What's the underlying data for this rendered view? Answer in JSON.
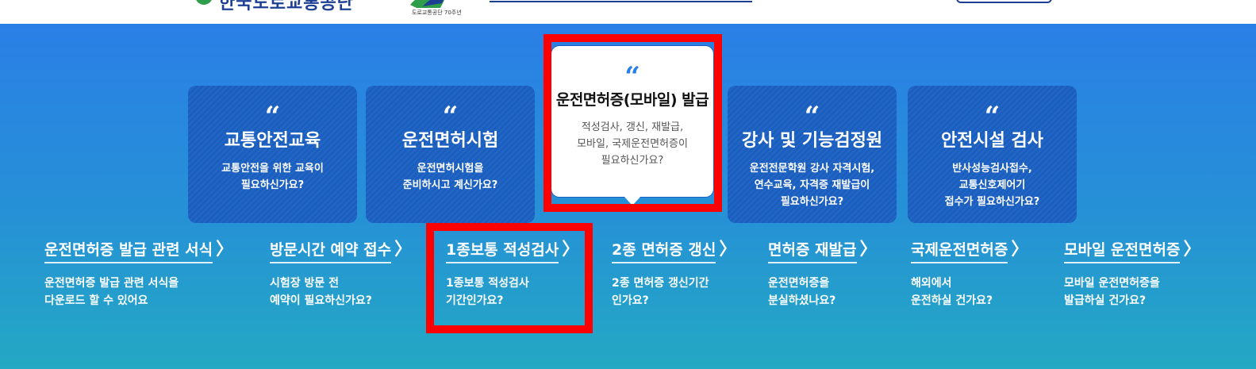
{
  "header": {
    "logo_text": "한국도로교통공단",
    "anniversary_label": "도로교통공단 70주년",
    "colors": {
      "brand": "#1c3f94",
      "leaf": "#2e9e4a"
    }
  },
  "cards": [
    {
      "quote": "“",
      "title": "교통안전교육",
      "desc": "교통안전을 위한 교육이\n필요하신가요?"
    },
    {
      "quote": "“",
      "title": "운전면허시험",
      "desc": "운전면허시험을\n준비하시고 계신가요?"
    },
    {
      "quote": "“",
      "title": "운전면허증(모바일) 발급",
      "desc": "적성검사, 갱신, 재발급,\n모바일, 국제운전면허증이\n필요하신가요?"
    },
    {
      "quote": "“",
      "title": "강사 및 기능검정원",
      "desc": "운전전문학원 강사 자격시험,\n연수교육, 자격증 재발급이\n필요하신가요?"
    },
    {
      "quote": "“",
      "title": "안전시설 검사",
      "desc": "반사성능검사접수,\n교통신호제어기\n접수가 필요하신가요?"
    }
  ],
  "links": [
    {
      "title": "운전면허증 발급 관련 서식",
      "chevron": "〉",
      "desc": "운전면허증 발급 관련 서식을\n다운로드 할 수 있어요"
    },
    {
      "title": "방문시간 예약 접수",
      "chevron": "〉",
      "desc": "시험장 방문 전\n예약이 필요하신가요?"
    },
    {
      "title": "1종보통 적성검사",
      "chevron": "〉",
      "desc": "1종보통 적성검사\n기간인가요?"
    },
    {
      "title": "2종 면허증 갱신",
      "chevron": "〉",
      "desc": "2종 면허증 갱신기간\n인가요?"
    },
    {
      "title": "면허증 재발급",
      "chevron": "〉",
      "desc": "운전면허증을\n분실하셨나요?"
    },
    {
      "title": "국제운전면허증",
      "chevron": "〉",
      "desc": "해외에서\n운전하실 건가요?"
    },
    {
      "title": "모바일 운전면허증",
      "chevron": "〉",
      "desc": "모바일 운전면허증을\n발급하실 건가요?"
    }
  ],
  "theme": {
    "hero_top": "#2a7fe6",
    "hero_bottom": "#23a9c3",
    "card_bg": "#1a5fc0",
    "highlight": "#ff0000",
    "quote_active": "#2a7fe6"
  }
}
